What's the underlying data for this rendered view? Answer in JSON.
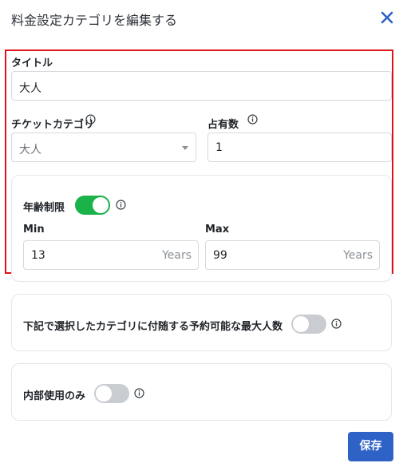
{
  "dialog": {
    "title": "料金設定カテゴリを編集する",
    "close_icon": "close-icon"
  },
  "form": {
    "title_label": "タイトル",
    "title_value": "大人",
    "ticket_category_label": "チケットカテゴリ",
    "ticket_category_value": "大人",
    "occupancy_label": "占有数",
    "occupancy_value": "1",
    "age_limit": {
      "label": "年齢制限",
      "enabled": true,
      "min_label": "Min",
      "min_value": "13",
      "min_suffix": "Years",
      "max_label": "Max",
      "max_value": "99",
      "max_suffix": "Years"
    },
    "max_people": {
      "label": "下記で選択したカテゴリに付随する予約可能な最大人数",
      "enabled": false
    },
    "internal_only": {
      "label": "内部使用のみ",
      "enabled": false
    }
  },
  "actions": {
    "save_label": "保存"
  },
  "colors": {
    "accent": "#2e62c6",
    "toggle_on": "#1bb24a",
    "highlight": "#e0121b"
  }
}
